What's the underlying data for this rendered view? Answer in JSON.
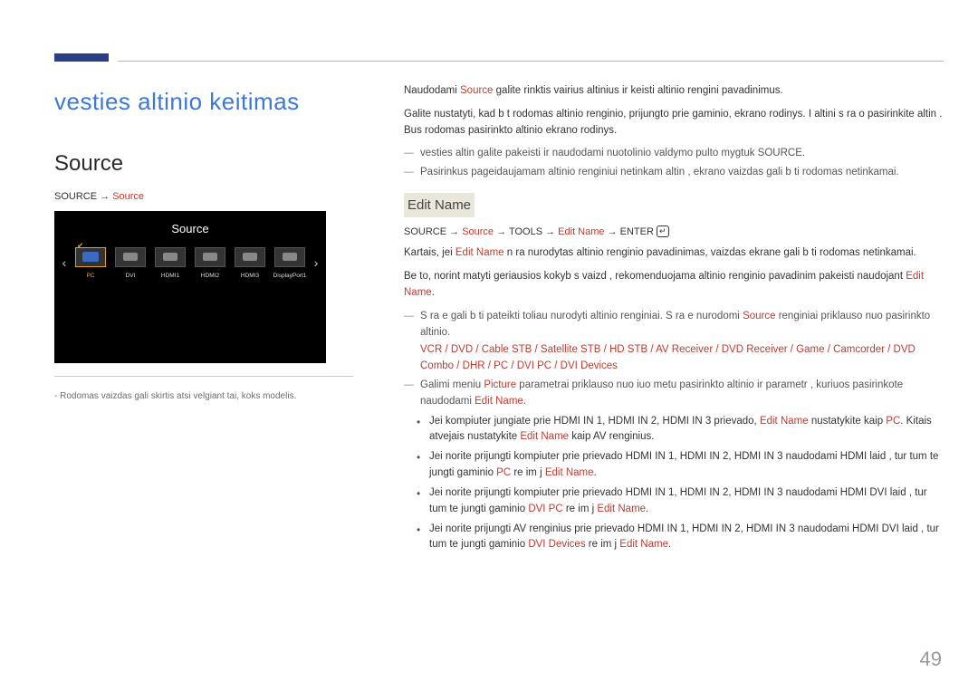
{
  "pageNumber": "49",
  "title": "vesties  altinio keitimas",
  "left": {
    "heading": "Source",
    "path_prefix": "SOURCE → ",
    "path_source": "Source",
    "osd": {
      "title": "Source",
      "arrow_left": "‹",
      "arrow_right": "›",
      "items": [
        {
          "label": "PC",
          "selected": true
        },
        {
          "label": "DVI",
          "selected": false
        },
        {
          "label": "HDMI1",
          "selected": false
        },
        {
          "label": "HDMI2",
          "selected": false
        },
        {
          "label": "HDMI3",
          "selected": false
        },
        {
          "label": "DisplayPort1",
          "selected": false
        }
      ]
    },
    "footnote_dash": "-",
    "footnote": "Rodomas vaizdas gali skirtis atsi velgiant   tai, koks modelis."
  },
  "right": {
    "p1_a": "Naudodami ",
    "p1_src": "Source",
    "p1_b": " galite rinktis  vairius  altinius ir keisti  altinio  rengini  pavadinimus.",
    "p2": "Galite nustatyti, kad b t  rodomas  altinio  renginio, prijungto prie gaminio, ekrano rodinys. I   altini  s ra o pasirinkite  altin . Bus rodomas pasirinkto  altinio ekrano rodinys.",
    "n1_a": "vesties  altin  galite pakeisti ir naudodami nuotolinio valdymo pulto mygtuk  ",
    "n1_b": "SOURCE",
    "n1_c": ".",
    "n2": "Pasirinkus pageidaujamam  altinio  renginiui netinkam   altin , ekrano vaizdas gali b ti rodomas netinkamai.",
    "editName": "Edit Name",
    "path2_a": "SOURCE → ",
    "path2_src": "Source",
    "path2_b": " → TOOLS → ",
    "path2_en": "Edit Name",
    "path2_c": " → ENTER ",
    "p3_a": "Kartais, jei ",
    "p3_en": "Edit Name",
    "p3_b": " n ra nurodytas  altinio  renginio pavadinimas, vaizdas ekrane gali b ti rodomas netinkamai.",
    "p4_a": "Be to, norint matyti geriausios kokyb s vaizd , rekomenduojama  altinio  renginio pavadinim  pakeisti naudojant ",
    "p4_en": "Edit Name",
    "p4_b": ".",
    "n3_a": "S ra e gali b ti pateikti toliau nurodyti  altinio  renginiai. S ra e nurodomi ",
    "n3_src": "Source",
    "n3_b": " renginiai priklauso nuo pasirinkto  altinio.",
    "devices": "VCR / DVD / Cable STB / Satellite STB / HD STB / AV Receiver / DVD Receiver / Game / Camcorder / DVD Combo / DHR / PC / DVI PC / DVI Devices",
    "n4_a": "Galimi meniu ",
    "n4_pic": "Picture",
    "n4_b": " parametrai priklauso nuo  iuo metu pasirinkto  altinio ir parametr , kuriuos pasirinkote naudodami ",
    "n4_en": "Edit Name",
    "n4_c": ".",
    "b1_a": "Jei kompiuter  jungiate prie HDMI IN 1, HDMI IN 2, HDMI IN 3 prievado, ",
    "b1_en": "Edit Name",
    "b1_b": " nustatykite kaip ",
    "b1_pc": "PC",
    "b1_c": ". Kitais atvejais nustatykite ",
    "b1_en2": "Edit Name",
    "b1_d": " kaip AV  renginius.",
    "b2_a": "Jei norite prijungti kompiuter  prie prievado HDMI IN 1, HDMI IN 2, HDMI IN 3 naudodami HDMI laid , tur tum te  jungti gaminio ",
    "b2_pc": "PC",
    "b2_b": " re im   j   ",
    "b2_en": "Edit Name",
    "b2_c": ".",
    "b3_a": "Jei norite prijungti kompiuter  prie prievado HDMI IN 1, HDMI IN 2, HDMI IN 3 naudodami HDMI DVI laid , tur tum te  jungti gaminio ",
    "b3_pc": "DVI PC",
    "b3_b": " re im   j   ",
    "b3_en": "Edit Name",
    "b3_c": ".",
    "b4_a": "Jei norite prijungti AV  renginius prie prievado ",
    "b4_h1": "HDMI IN 1",
    "b4_s1": ", ",
    "b4_h2": "HDMI IN 2",
    "b4_s2": ", ",
    "b4_h3": "HDMI IN 3",
    "b4_b": " naudodami HDMI DVI laid , tur tum te  jungti gaminio ",
    "b4_dv": "DVI Devices",
    "b4_c": " re im   j   ",
    "b4_en": "Edit Name",
    "b4_d": "."
  }
}
